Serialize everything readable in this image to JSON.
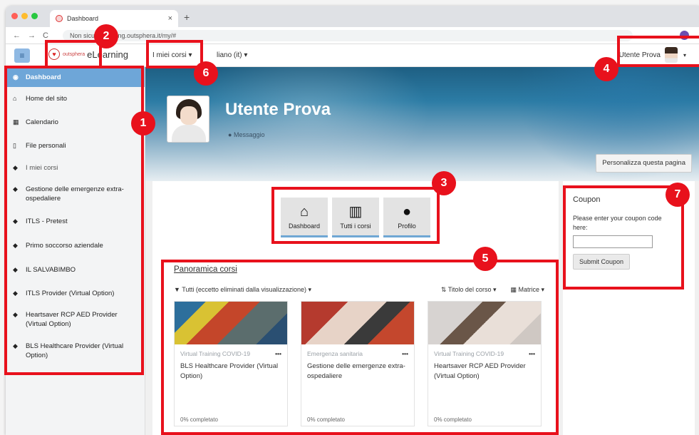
{
  "browser": {
    "tab_title": "Dashboard",
    "tab_close": "×",
    "new_tab": "+",
    "url": "Non sicuro  learning.outsphera.it/my/#",
    "nav_back": "←",
    "nav_forward": "→",
    "nav_reload": "C"
  },
  "navbar": {
    "menu_icon": "≡",
    "brand_small": "outsphera",
    "brand_big": "eLearning",
    "menu1": "I miei corsi ▾",
    "menu2": "liano (it) ▾",
    "user_name": "Utente Prova",
    "user_caret": "▾"
  },
  "sidebar": {
    "items": [
      {
        "label": "Dashboard",
        "icon": "dashboard-icon",
        "glyph": "◉"
      },
      {
        "label": "Home del sito",
        "icon": "home-icon",
        "glyph": "⌂"
      },
      {
        "label": "Calendario",
        "icon": "calendar-icon",
        "glyph": "▦"
      },
      {
        "label": "File personali",
        "icon": "file-icon",
        "glyph": "▯"
      },
      {
        "label": "I miei corsi",
        "icon": "mortarboard-icon",
        "glyph": "◆"
      },
      {
        "label": "Gestione delle emergenze extra-ospedaliere",
        "icon": "mortarboard-icon",
        "glyph": "◆"
      },
      {
        "label": "ITLS - Pretest",
        "icon": "mortarboard-icon",
        "glyph": "◆"
      },
      {
        "label": "Primo soccorso aziendale",
        "icon": "mortarboard-icon",
        "glyph": "◆"
      },
      {
        "label": "IL SALVABIMBO",
        "icon": "mortarboard-icon",
        "glyph": "◆"
      },
      {
        "label": "ITLS Provider (Virtual Option)",
        "icon": "mortarboard-icon",
        "glyph": "◆"
      },
      {
        "label": "Heartsaver RCP AED Provider (Virtual Option)",
        "icon": "mortarboard-icon",
        "glyph": "◆"
      },
      {
        "label": "BLS Healthcare Provider (Virtual Option)",
        "icon": "mortarboard-icon",
        "glyph": "◆"
      }
    ]
  },
  "header": {
    "name": "Utente Prova",
    "message": "Messaggio",
    "customize_button": "Personalizza questa pagina"
  },
  "quick_links": [
    {
      "label": "Dashboard",
      "glyph": "⌂",
      "icon": "home-icon"
    },
    {
      "label": "Tutti i corsi",
      "glyph": "▥",
      "icon": "book-icon"
    },
    {
      "label": "Profilo",
      "glyph": "●",
      "icon": "user-icon"
    }
  ],
  "overview": {
    "title": "Panoramica corsi",
    "filter": "▼ Tutti (eccetto eliminati dalla visualizzazione) ▾",
    "sort": "⇅ Titolo del corso ▾",
    "view": "▦ Matrice ▾",
    "courses": [
      {
        "category": "Virtual Training COVID-19",
        "name": "BLS Healthcare Provider (Virtual Option)",
        "progress": "0% completato",
        "menu": "•••"
      },
      {
        "category": "Emergenza sanitaria",
        "name": "Gestione delle emergenze extra-ospedaliere",
        "progress": "0% completato",
        "menu": "•••"
      },
      {
        "category": "Virtual Training COVID-19",
        "name": "Heartsaver RCP AED Provider (Virtual Option)",
        "progress": "0% completato",
        "menu": "•••"
      }
    ]
  },
  "coupon": {
    "title": "Coupon",
    "text": "Please enter your coupon code here:",
    "input_value": "",
    "button": "Submit Coupon"
  },
  "annotations": [
    "1",
    "2",
    "3",
    "4",
    "5",
    "6",
    "7"
  ],
  "colors": {
    "accent": "#6ea6d8",
    "annotation": "#e8111c"
  }
}
